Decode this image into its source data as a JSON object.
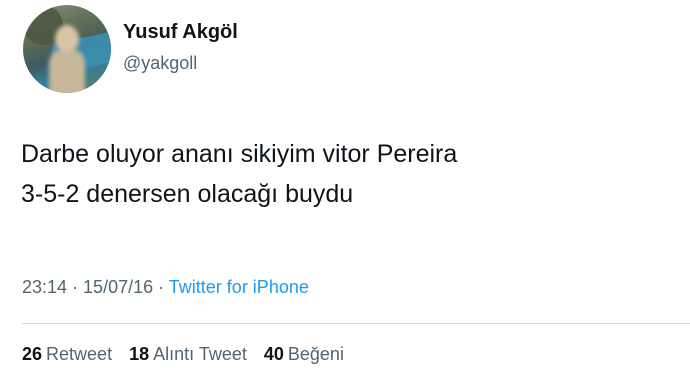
{
  "user": {
    "display_name": "Yusuf Akgöl",
    "handle": "@yakgoll"
  },
  "tweet": {
    "line1": "Darbe oluyor ananı sikiyim vitor Pereira",
    "line2": "3-5-2 denersen olacağı buydu"
  },
  "meta": {
    "time": "23:14",
    "separator": " · ",
    "date": "15/07/16",
    "separator2": " · ",
    "source": "Twitter for iPhone"
  },
  "stats": {
    "retweets_count": "26",
    "retweets_label": "Retweet",
    "quotes_count": "18",
    "quotes_label": "Alıntı Tweet",
    "likes_count": "40",
    "likes_label": "Beğeni"
  },
  "colors": {
    "link": "#1d9bf0",
    "secondary_text": "#536471",
    "primary_text": "#0f1419"
  }
}
